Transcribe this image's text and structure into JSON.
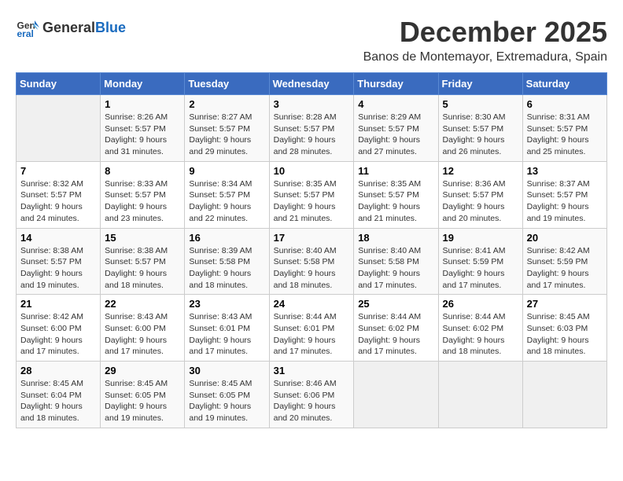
{
  "logo": {
    "general": "General",
    "blue": "Blue"
  },
  "title": "December 2025",
  "subtitle": "Banos de Montemayor, Extremadura, Spain",
  "days": [
    "Sunday",
    "Monday",
    "Tuesday",
    "Wednesday",
    "Thursday",
    "Friday",
    "Saturday"
  ],
  "weeks": [
    [
      {
        "day": "",
        "info": ""
      },
      {
        "day": "1",
        "info": "Sunrise: 8:26 AM\nSunset: 5:57 PM\nDaylight: 9 hours\nand 31 minutes."
      },
      {
        "day": "2",
        "info": "Sunrise: 8:27 AM\nSunset: 5:57 PM\nDaylight: 9 hours\nand 29 minutes."
      },
      {
        "day": "3",
        "info": "Sunrise: 8:28 AM\nSunset: 5:57 PM\nDaylight: 9 hours\nand 28 minutes."
      },
      {
        "day": "4",
        "info": "Sunrise: 8:29 AM\nSunset: 5:57 PM\nDaylight: 9 hours\nand 27 minutes."
      },
      {
        "day": "5",
        "info": "Sunrise: 8:30 AM\nSunset: 5:57 PM\nDaylight: 9 hours\nand 26 minutes."
      },
      {
        "day": "6",
        "info": "Sunrise: 8:31 AM\nSunset: 5:57 PM\nDaylight: 9 hours\nand 25 minutes."
      }
    ],
    [
      {
        "day": "7",
        "info": "Sunrise: 8:32 AM\nSunset: 5:57 PM\nDaylight: 9 hours\nand 24 minutes."
      },
      {
        "day": "8",
        "info": "Sunrise: 8:33 AM\nSunset: 5:57 PM\nDaylight: 9 hours\nand 23 minutes."
      },
      {
        "day": "9",
        "info": "Sunrise: 8:34 AM\nSunset: 5:57 PM\nDaylight: 9 hours\nand 22 minutes."
      },
      {
        "day": "10",
        "info": "Sunrise: 8:35 AM\nSunset: 5:57 PM\nDaylight: 9 hours\nand 21 minutes."
      },
      {
        "day": "11",
        "info": "Sunrise: 8:35 AM\nSunset: 5:57 PM\nDaylight: 9 hours\nand 21 minutes."
      },
      {
        "day": "12",
        "info": "Sunrise: 8:36 AM\nSunset: 5:57 PM\nDaylight: 9 hours\nand 20 minutes."
      },
      {
        "day": "13",
        "info": "Sunrise: 8:37 AM\nSunset: 5:57 PM\nDaylight: 9 hours\nand 19 minutes."
      }
    ],
    [
      {
        "day": "14",
        "info": "Sunrise: 8:38 AM\nSunset: 5:57 PM\nDaylight: 9 hours\nand 19 minutes."
      },
      {
        "day": "15",
        "info": "Sunrise: 8:38 AM\nSunset: 5:57 PM\nDaylight: 9 hours\nand 18 minutes."
      },
      {
        "day": "16",
        "info": "Sunrise: 8:39 AM\nSunset: 5:58 PM\nDaylight: 9 hours\nand 18 minutes."
      },
      {
        "day": "17",
        "info": "Sunrise: 8:40 AM\nSunset: 5:58 PM\nDaylight: 9 hours\nand 18 minutes."
      },
      {
        "day": "18",
        "info": "Sunrise: 8:40 AM\nSunset: 5:58 PM\nDaylight: 9 hours\nand 17 minutes."
      },
      {
        "day": "19",
        "info": "Sunrise: 8:41 AM\nSunset: 5:59 PM\nDaylight: 9 hours\nand 17 minutes."
      },
      {
        "day": "20",
        "info": "Sunrise: 8:42 AM\nSunset: 5:59 PM\nDaylight: 9 hours\nand 17 minutes."
      }
    ],
    [
      {
        "day": "21",
        "info": "Sunrise: 8:42 AM\nSunset: 6:00 PM\nDaylight: 9 hours\nand 17 minutes."
      },
      {
        "day": "22",
        "info": "Sunrise: 8:43 AM\nSunset: 6:00 PM\nDaylight: 9 hours\nand 17 minutes."
      },
      {
        "day": "23",
        "info": "Sunrise: 8:43 AM\nSunset: 6:01 PM\nDaylight: 9 hours\nand 17 minutes."
      },
      {
        "day": "24",
        "info": "Sunrise: 8:44 AM\nSunset: 6:01 PM\nDaylight: 9 hours\nand 17 minutes."
      },
      {
        "day": "25",
        "info": "Sunrise: 8:44 AM\nSunset: 6:02 PM\nDaylight: 9 hours\nand 17 minutes."
      },
      {
        "day": "26",
        "info": "Sunrise: 8:44 AM\nSunset: 6:02 PM\nDaylight: 9 hours\nand 18 minutes."
      },
      {
        "day": "27",
        "info": "Sunrise: 8:45 AM\nSunset: 6:03 PM\nDaylight: 9 hours\nand 18 minutes."
      }
    ],
    [
      {
        "day": "28",
        "info": "Sunrise: 8:45 AM\nSunset: 6:04 PM\nDaylight: 9 hours\nand 18 minutes."
      },
      {
        "day": "29",
        "info": "Sunrise: 8:45 AM\nSunset: 6:05 PM\nDaylight: 9 hours\nand 19 minutes."
      },
      {
        "day": "30",
        "info": "Sunrise: 8:45 AM\nSunset: 6:05 PM\nDaylight: 9 hours\nand 19 minutes."
      },
      {
        "day": "31",
        "info": "Sunrise: 8:46 AM\nSunset: 6:06 PM\nDaylight: 9 hours\nand 20 minutes."
      },
      {
        "day": "",
        "info": ""
      },
      {
        "day": "",
        "info": ""
      },
      {
        "day": "",
        "info": ""
      }
    ]
  ]
}
